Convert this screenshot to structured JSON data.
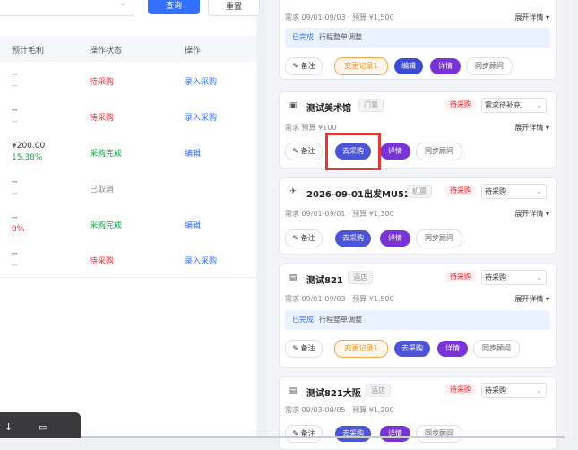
{
  "filters": {
    "query_label": "查询",
    "reset_label": "重置"
  },
  "table": {
    "headers": [
      "预计毛利",
      "操作状态",
      "操作"
    ],
    "rows": [
      {
        "profit": "--",
        "profit_sub": "--",
        "status": "待采购",
        "status_color": "red",
        "action": "录入采购"
      },
      {
        "profit": "--",
        "profit_sub": "--",
        "status": "待采购",
        "status_color": "red",
        "action": "录入采购"
      },
      {
        "profit": "¥200.00",
        "profit_sub": "15.38%",
        "status": "采购完成",
        "status_color": "green",
        "action": "编辑"
      },
      {
        "profit": "--",
        "profit_sub": "--",
        "status": "已取消",
        "status_color": "gray",
        "action": ""
      },
      {
        "profit": "--",
        "profit_sub": "0%",
        "status": "采购完成",
        "status_color": "green",
        "action": "编辑"
      },
      {
        "profit": "--",
        "profit_sub": "--",
        "status": "待采购",
        "status_color": "red",
        "action": "录入采购"
      }
    ]
  },
  "cards": [
    {
      "need": "需求 09/01-09/03 · 预算 ¥1,500",
      "expand": "展开详情 ▾",
      "notice_done": "已完成",
      "notice_text": "行程整单调整",
      "btn_note": "✎ 备注",
      "btn_change": "变更记录1",
      "btn_edit": "编辑",
      "btn_detail": "详情",
      "btn_sync": "同步顾问"
    },
    {
      "title": "测试美术馆",
      "tag": "门票",
      "status": "待采购",
      "select": "需求待补充",
      "need": "需求 预算 ¥100",
      "expand": "展开详情 ▾",
      "btn_note": "✎ 备注",
      "btn_buy": "去采购",
      "btn_detail": "详情",
      "btn_sync": "同步顾问"
    },
    {
      "title": "2026-09-01出发MU521",
      "tag": "机票",
      "status": "待采购",
      "select": "待采购",
      "need": "需求 09/01-09/01 · 预算 ¥1,300",
      "expand": "展开详情 ▾",
      "btn_note": "✎ 备注",
      "btn_buy": "去采购",
      "btn_detail": "详情",
      "btn_sync": "同步顾问"
    },
    {
      "title": "测试821",
      "tag": "酒店",
      "status": "待采购",
      "select": "待采购",
      "need": "需求 09/01-09/03 · 预算 ¥1,500",
      "expand": "展开详情 ▾",
      "notice_done": "已完成",
      "notice_text": "行程整单调整",
      "btn_note": "✎ 备注",
      "btn_change": "变更记录1",
      "btn_buy": "去采购",
      "btn_detail": "详情",
      "btn_sync": "同步顾问"
    },
    {
      "title": "测试821大阪",
      "tag": "酒店",
      "status": "待采购",
      "select": "待采购",
      "need": "需求 09/03-09/05 · 预算 ¥1,200",
      "btn_note": "✎ 备注",
      "btn_buy": "去采购",
      "btn_detail": "详情",
      "btn_sync": "同步顾问"
    }
  ],
  "colors": {
    "primary": "#3370ff",
    "danger": "#f5222d",
    "success": "#19a34a",
    "purple": "#7a33d6",
    "highlight": "#e53935"
  },
  "icons": {
    "ticket": "ticket-icon",
    "flight": "plane-icon",
    "hotel": "hotel-icon",
    "download": "download-icon",
    "doc": "document-icon"
  }
}
